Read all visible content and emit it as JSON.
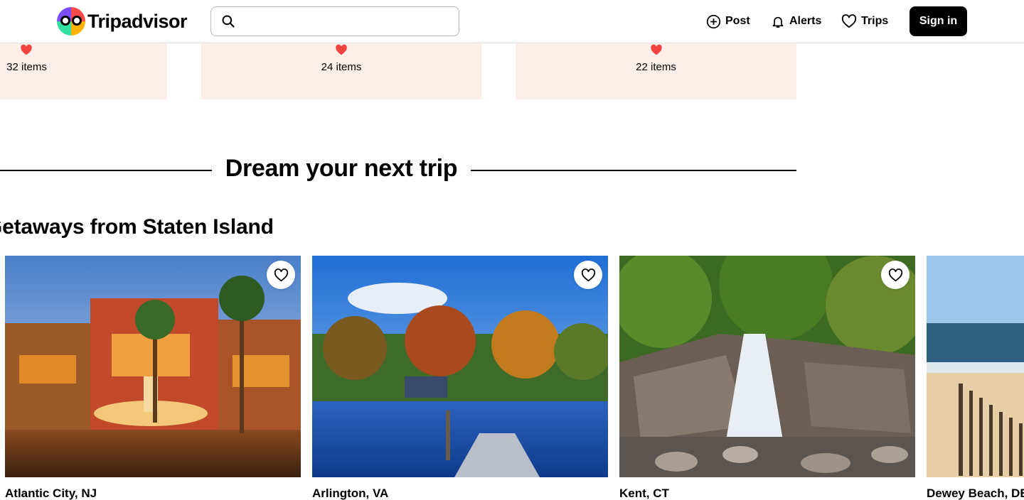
{
  "header": {
    "brand": "Tripadvisor",
    "search": {
      "value": "",
      "placeholder": "",
      "icon": "search-icon"
    },
    "nav": [
      {
        "label": "Post",
        "icon": "plus-circle-icon"
      },
      {
        "label": "Alerts",
        "icon": "bell-icon"
      },
      {
        "label": "Trips",
        "icon": "heart-outline-icon"
      }
    ],
    "signin_label": "Sign in"
  },
  "collections": [
    {
      "count": "32 items",
      "icon": "heart-filled-icon"
    },
    {
      "count": "24 items",
      "icon": "heart-filled-icon"
    },
    {
      "count": "22 items",
      "icon": "heart-filled-icon"
    }
  ],
  "dream_heading": "Dream your next trip",
  "section_title": "Getaways from Staten Island",
  "destinations": [
    {
      "name": "Atlantic City, NJ"
    },
    {
      "name": "Arlington, VA"
    },
    {
      "name": "Kent, CT"
    },
    {
      "name": "Dewey Beach, DE"
    }
  ],
  "colors": {
    "accent": "#000000",
    "heart": "#f2433f",
    "collection_bg": "#fcefea"
  }
}
